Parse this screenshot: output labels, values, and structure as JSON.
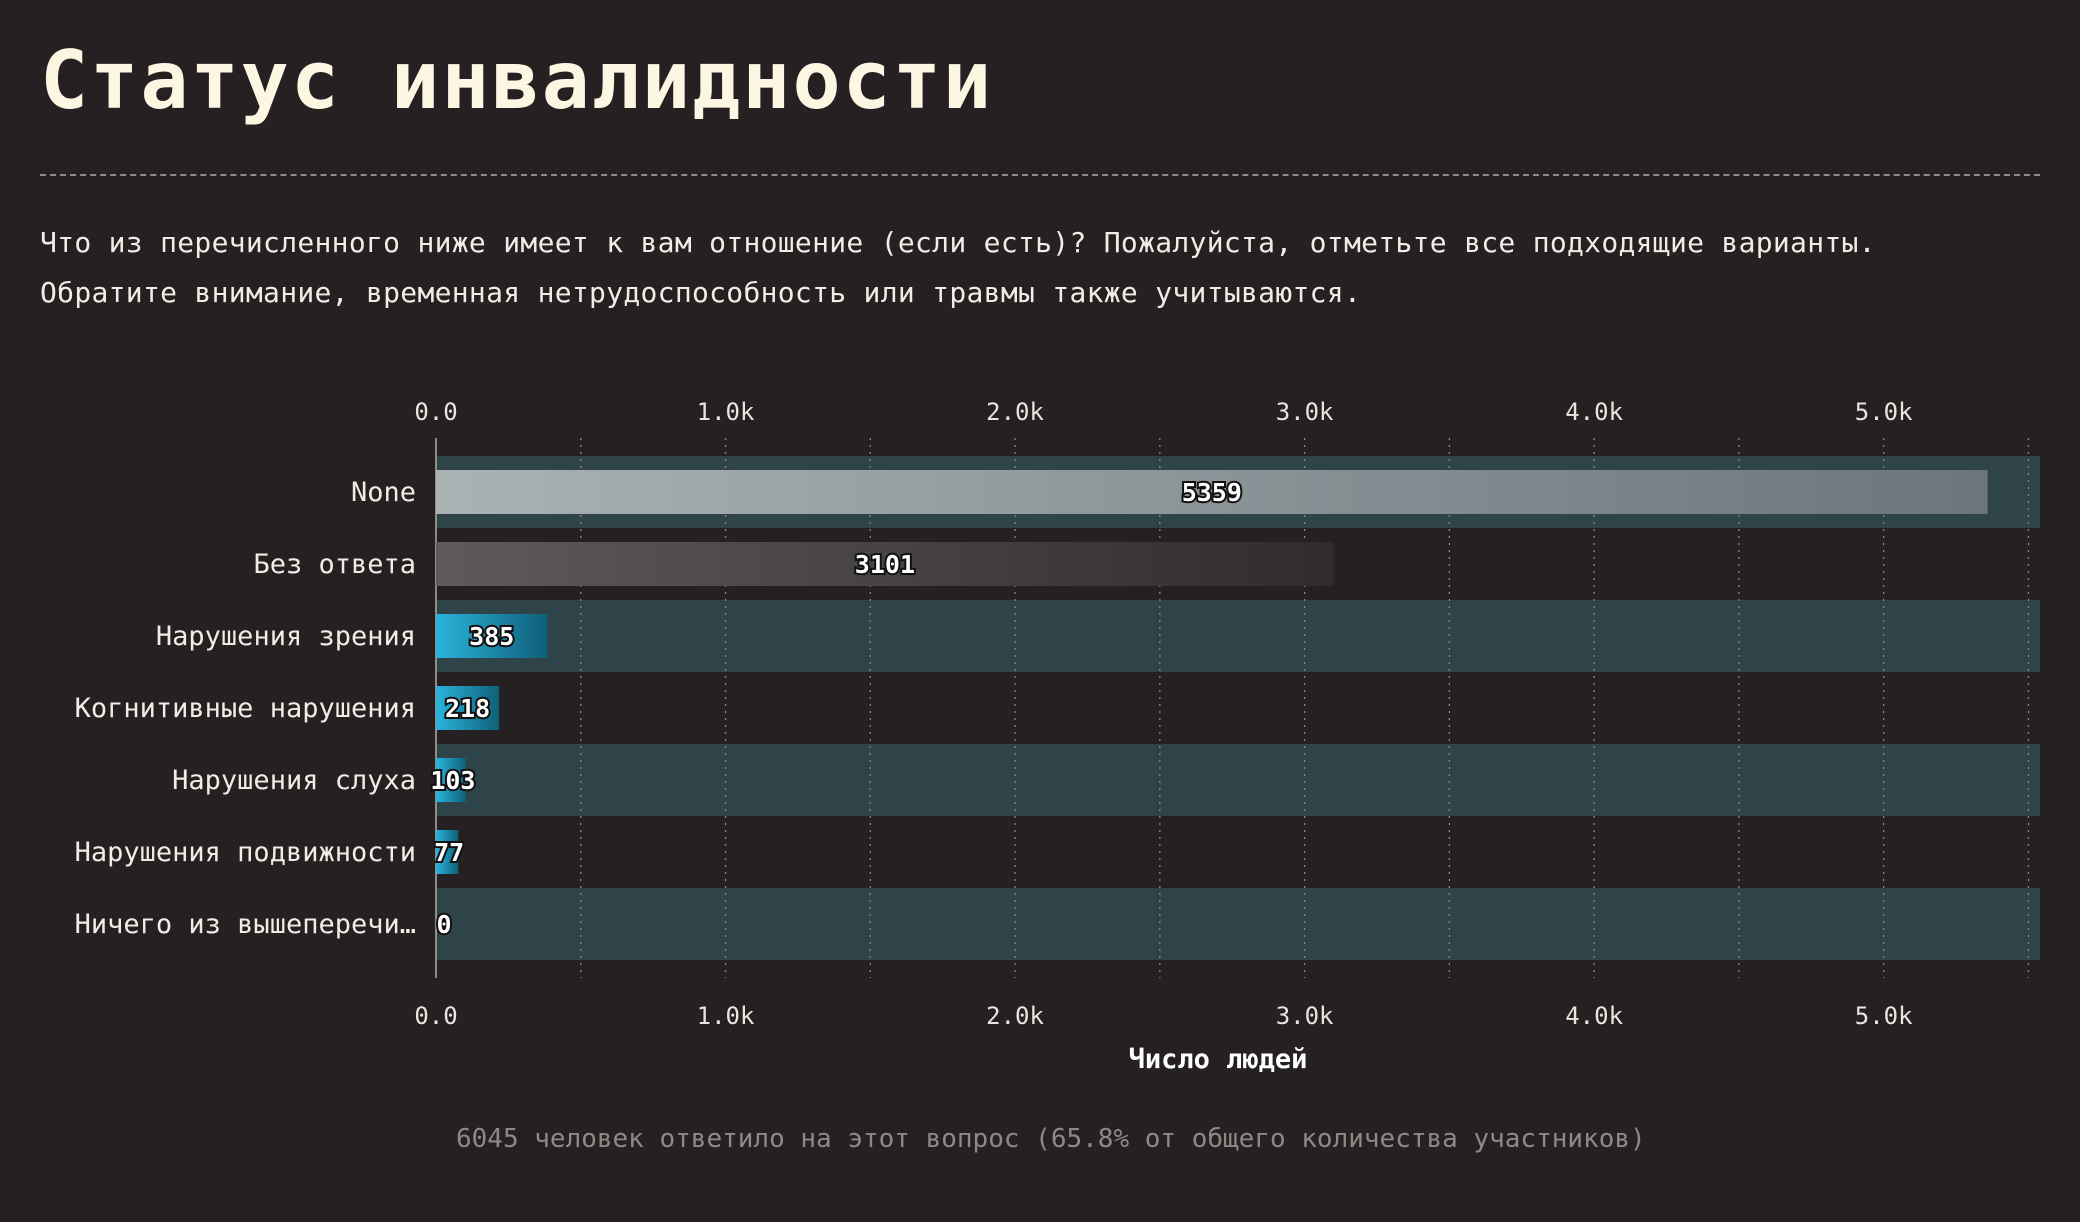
{
  "title": "Статус инвалидности",
  "question": {
    "line1": "Что из перечисленного ниже имеет к вам отношение (если есть)? Пожалуйста, отметьте все подходящие варианты.",
    "line2": "Обратите внимание, временная нетрудоспособность или травмы также учитываются."
  },
  "footnote": "6045 человек ответило на этот вопрос (65.8% от общего количества участников)",
  "colors": {
    "background": "#252123",
    "band": "#2f4448",
    "none_bar": [
      "#aab2b3",
      "#6a767c"
    ],
    "no_answer_bar": [
      "#5e5a5c",
      "#302c2e"
    ],
    "accent_bar": [
      "#2bb4dc",
      "#0f5f78"
    ]
  },
  "chart_data": {
    "type": "bar",
    "orientation": "horizontal",
    "categories": [
      "None",
      "Без ответа",
      "Нарушения зрения",
      "Когнитивные нарушения",
      "Нарушения слуха",
      "Нарушения подвижности",
      "Ничего из вышеперечи…"
    ],
    "values": [
      5359,
      3101,
      385,
      218,
      103,
      77,
      0
    ],
    "xlabel": "Число людей",
    "xlim": [
      0,
      5540
    ],
    "xticks": [
      0,
      1000,
      2000,
      3000,
      4000,
      5000
    ],
    "xtick_labels": [
      "0.0",
      "1.0k",
      "2.0k",
      "3.0k",
      "4.0k",
      "5.0k"
    ],
    "grid": "vertical dotted",
    "axis_labels_top_and_bottom": true,
    "legend": "none"
  }
}
